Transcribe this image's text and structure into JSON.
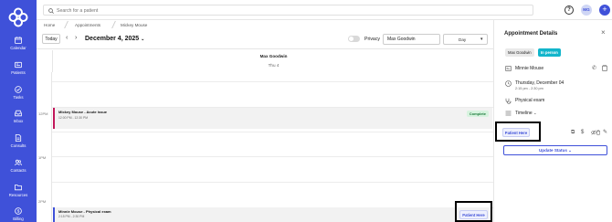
{
  "colors": {
    "brand": "#3F51D9",
    "event_accent_pink": "#C2185B",
    "complete_bg": "#D7F3DF",
    "complete_text": "#1D7A3C",
    "in_person": "#12B5CB"
  },
  "sidebar": {
    "logo_icon": "flower-logo",
    "items": [
      {
        "label": "Calendar",
        "icon": "calendar-icon"
      },
      {
        "label": "Patients",
        "icon": "id-card-icon"
      },
      {
        "label": "Tasks",
        "icon": "check-circle-icon"
      },
      {
        "label": "Inbox",
        "icon": "inbox-icon"
      },
      {
        "label": "Consults",
        "icon": "document-icon"
      },
      {
        "label": "Contacts",
        "icon": "people-icon"
      },
      {
        "label": "Resources",
        "icon": "folder-icon"
      },
      {
        "label": "Billing",
        "icon": "dollar-icon"
      }
    ]
  },
  "topbar": {
    "search_placeholder": "Search for a patient",
    "help_glyph": "?",
    "avatar_initials": "MG",
    "add_glyph": "+"
  },
  "breadcrumb": [
    "Home",
    "Appointments",
    "Mickey Mouse"
  ],
  "toolbar": {
    "today_label": "Today",
    "prev_glyph": "‹",
    "next_glyph": "›",
    "date_title": "December 4, 2025",
    "privacy_label": "Privacy",
    "provider_value": "Max Goodwin",
    "view_value": "Day"
  },
  "calendar": {
    "provider": "Max Goodwin",
    "day_label": "Thu 4",
    "time_labels": [
      "12PM",
      "1PM",
      "2PM"
    ],
    "events": [
      {
        "title": "Mickey Mouse - Acute issue",
        "time": "12:00 PM - 12:30 PM",
        "status": "Complete"
      },
      {
        "title": "Minnie Mouse - Physical exam",
        "time": "2:15 PM - 2:30 PM",
        "action": "Patient Here"
      }
    ]
  },
  "panel": {
    "title": "Appointment Details",
    "chips": [
      "Max Goodwin",
      "In person"
    ],
    "patient_name": "Minnie Mouse",
    "date": "Thursday, December 04",
    "time": "2:15 pm - 2:30 pm",
    "visit_type": "Physical exam",
    "timeline_label": "Timeline",
    "patient_here_label": "Patient Here",
    "update_status_label": "Update Status"
  }
}
